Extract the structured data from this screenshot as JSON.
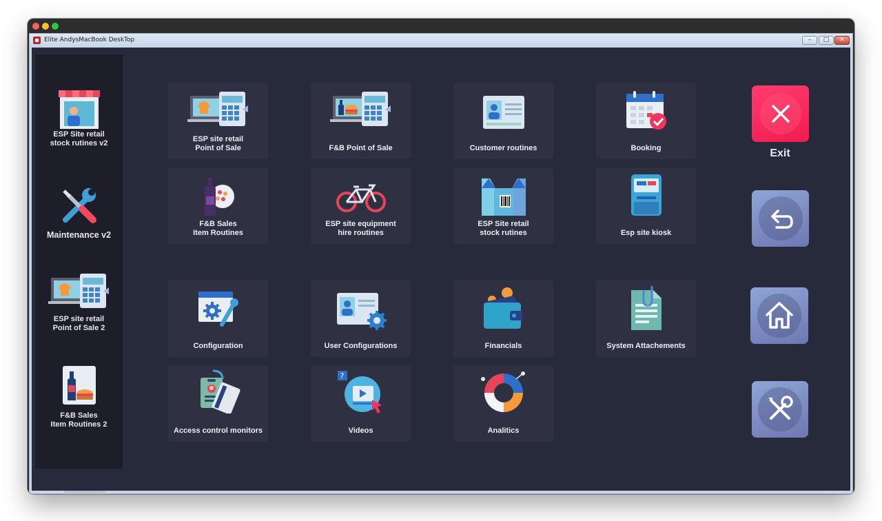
{
  "window": {
    "title": "Elite AndysMacBook DeskTop",
    "controls": {
      "minimize": "–",
      "maximize": "□",
      "close": "✕"
    }
  },
  "sidebar": {
    "items": [
      {
        "label": "ESP Site retail\nstock rutines v2",
        "icon": "storefront-icon"
      },
      {
        "label": "Maintenance v2",
        "icon": "wrench-screwdriver-icon"
      },
      {
        "label": "ESP site retail\nPoint of Sale 2",
        "icon": "retail-pos-icon"
      },
      {
        "label": "F&B Sales\nItem Routines  2",
        "icon": "wine-burger-icon"
      }
    ]
  },
  "tiles": [
    {
      "label": "ESP site retail\nPoint of Sale",
      "icon": "retail-pos-icon"
    },
    {
      "label": "F&B Point of Sale",
      "icon": "fnb-pos-icon"
    },
    {
      "label": "Customer routines",
      "icon": "id-card-icon"
    },
    {
      "label": "Booking",
      "icon": "calendar-check-icon"
    },
    {
      "label": "F&B Sales\nItem Routines",
      "icon": "wine-plate-icon"
    },
    {
      "label": "ESP site equipment\nhire routines",
      "icon": "bicycle-icon"
    },
    {
      "label": "ESP Site retail\nstock rutines",
      "icon": "box-barcode-icon"
    },
    {
      "label": "Esp site kiosk",
      "icon": "kiosk-icon"
    },
    {
      "label": "Configuration",
      "icon": "config-gear-icon"
    },
    {
      "label": "User Configurations",
      "icon": "user-gear-icon"
    },
    {
      "label": "Financials",
      "icon": "wallet-icon"
    },
    {
      "label": "System Attachements",
      "icon": "attachment-doc-icon"
    },
    {
      "label": "Access control monitors",
      "icon": "access-badge-icon"
    },
    {
      "label": "Videos",
      "icon": "video-play-icon"
    },
    {
      "label": "Analitics",
      "icon": "donut-chart-icon"
    }
  ],
  "actions": {
    "exit_label": "Exit",
    "exit_icon": "close-icon",
    "back_icon": "undo-arrow-icon",
    "home_icon": "home-icon",
    "tools_icon": "tools-icon"
  },
  "colors": {
    "background": "#272a3a",
    "sidebar": "#1d1e2a",
    "tile": "#2f3142",
    "exit": "#f5265a",
    "action_blue": "#7f90c8"
  }
}
